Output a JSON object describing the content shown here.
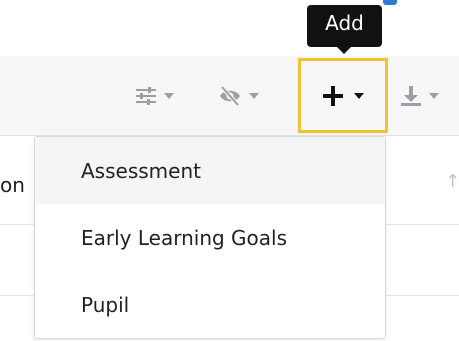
{
  "tooltip": {
    "text": "Add"
  },
  "toolbar": {
    "buttons": [
      {
        "icon": "columns-sliders-icon"
      },
      {
        "icon": "eye-slash-icon"
      },
      {
        "icon": "plus-icon"
      },
      {
        "icon": "download-icon"
      }
    ],
    "accent_color": "#2b7bd1",
    "highlight_color": "#f2c230"
  },
  "table": {
    "header_fragment": "on",
    "sort_icon": "sort-icon"
  },
  "menu": {
    "items": [
      {
        "label": "Assessment"
      },
      {
        "label": "Early Learning Goals"
      },
      {
        "label": "Pupil"
      }
    ]
  }
}
